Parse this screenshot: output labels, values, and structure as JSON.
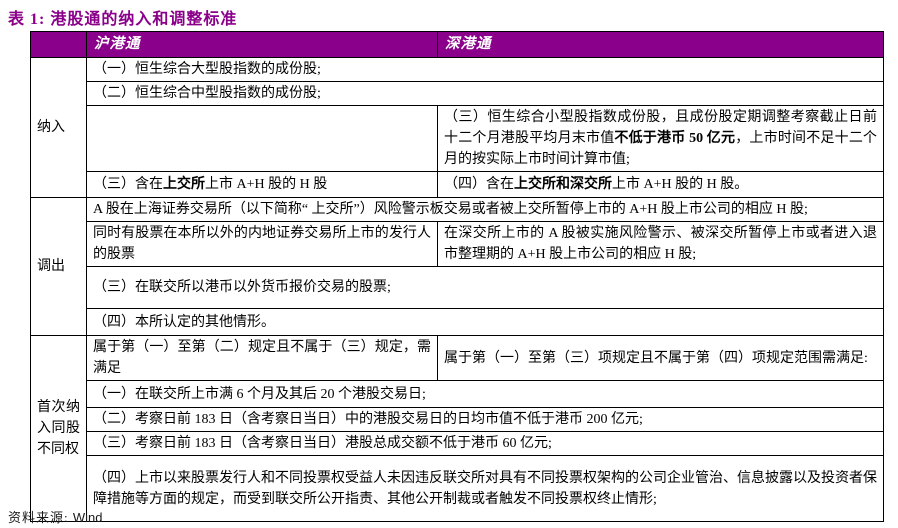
{
  "title": "表 1:  港股通的纳入和调整标准",
  "colors": {
    "accent_purple": "#8a008a",
    "header_bg": "#8a008a",
    "header_fg": "#ffffff",
    "border": "#000000",
    "body_text": "#000000"
  },
  "header": {
    "col1": "沪港通",
    "col2": "深港通"
  },
  "sections": {
    "inclusion": {
      "label": "纳入",
      "row1": "（一）恒生综合大型股指数的成份股;",
      "row2": "（二）恒生综合中型股指数的成份股;",
      "row3_left": "",
      "row3_right_pre": "（三）恒生综合小型股指数成份股，且成份股定期调整考察截止日前十二个月港股平均月末市值",
      "row3_right_bold": "不低于港币 50 亿元",
      "row3_right_post": "，上市时间不足十二个月的按实际上市时间计算市值;",
      "row4_left_pre": "（三）含在",
      "row4_left_bold": "上交所",
      "row4_left_post": "上市 A+H 股的 H 股",
      "row4_right_pre": "（四）含在",
      "row4_right_bold": "上交所和深交所",
      "row4_right_post": "上市 A+H 股的 H 股。"
    },
    "removal": {
      "label": "调出",
      "row1": "A 股在上海证券交易所（以下简称“ 上交所”）风险警示板交易或者被上交所暂停上市的 A+H 股上市公司的相应 H 股;",
      "row2_left": "同时有股票在本所以外的内地证券交易所上市的发行人的股票",
      "row2_right": "在深交所上市的 A 股被实施风险警示、被深交所暂停上市或者进入退市整理期的 A+H 股上市公司的相应 H 股;",
      "row3": "（三）在联交所以港币以外货币报价交易的股票;",
      "row4": "（四）本所认定的其他情形。"
    },
    "wvr": {
      "label": "首次纳入同股不同权",
      "row1_left": "属于第（一）至第（二）规定且不属于（三）规定，需满足",
      "row1_right": "属于第（一）至第（三）项规定且不属于第（四）项规定范围需满足:",
      "row2": "（一）在联交所上市满 6 个月及其后 20 个港股交易日;",
      "row3": "（二）考察日前 183 日（含考察日当日）中的港股交易日的日均市值不低于港币 200 亿元;",
      "row4": "（三）考察日前 183 日（含考察日当日）港股总成交额不低于港币 60 亿元;",
      "row5": "（四）上市以来股票发行人和不同投票权受益人未因违反联交所对具有不同投票权架构的公司企业管治、信息披露以及投资者保障措施等方面的规定，而受到联交所公开指责、其他公开制裁或者触发不同投票权终止情形;"
    }
  },
  "footer": {
    "source_label": "资料来源:",
    "source_value": "Wind"
  }
}
